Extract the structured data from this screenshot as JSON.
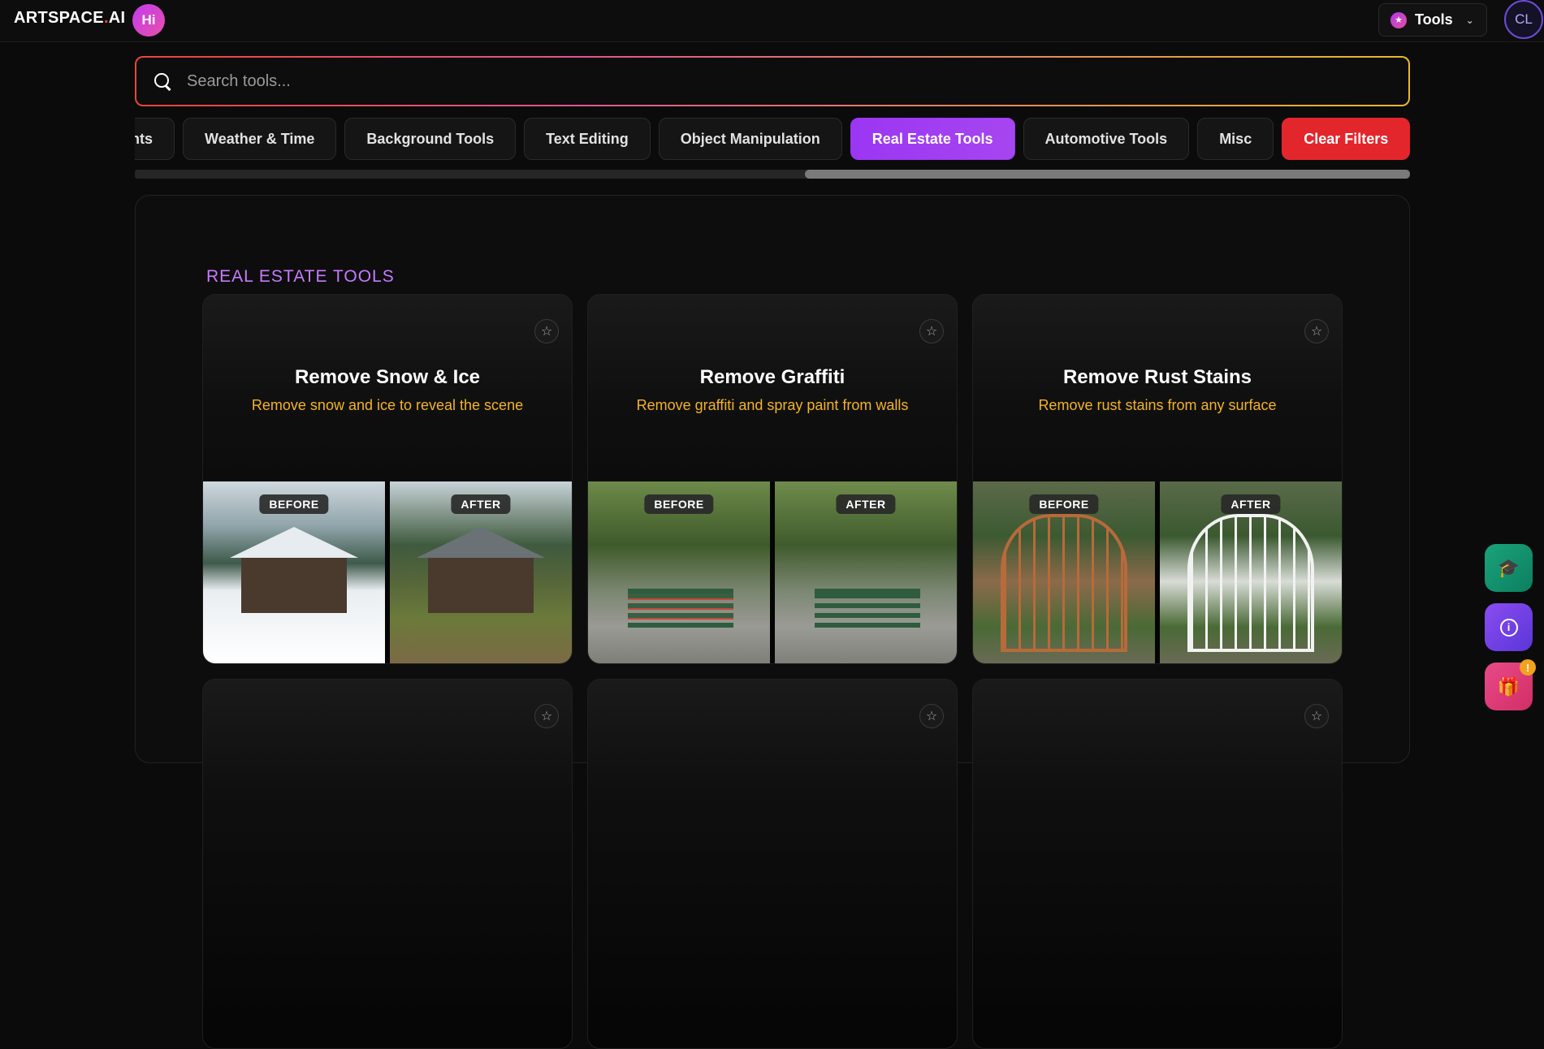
{
  "header": {
    "logo_main": "ARTSPACE",
    "logo_dot": ".",
    "logo_suffix": "AI",
    "hi_badge": "Hi",
    "tools_label": "Tools",
    "avatar_initials": "CL"
  },
  "search": {
    "placeholder": "Search tools..."
  },
  "filters": [
    {
      "label": "ements",
      "active": false
    },
    {
      "label": "Weather & Time",
      "active": false
    },
    {
      "label": "Background Tools",
      "active": false
    },
    {
      "label": "Text Editing",
      "active": false
    },
    {
      "label": "Object Manipulation",
      "active": false
    },
    {
      "label": "Real Estate Tools",
      "active": true
    },
    {
      "label": "Automotive Tools",
      "active": false
    },
    {
      "label": "Misc",
      "active": false
    }
  ],
  "clear_filters_label": "Clear Filters",
  "section": {
    "title": "REAL ESTATE TOOLS"
  },
  "cards": [
    {
      "title": "Remove Snow & Ice",
      "description": "Remove snow and ice to reveal the scene",
      "before_label": "BEFORE",
      "after_label": "AFTER"
    },
    {
      "title": "Remove Graffiti",
      "description": "Remove graffiti and spray paint from walls",
      "before_label": "BEFORE",
      "after_label": "AFTER"
    },
    {
      "title": "Remove Rust Stains",
      "description": "Remove rust stains from any surface",
      "before_label": "BEFORE",
      "after_label": "AFTER"
    }
  ],
  "fab": {
    "gift_badge": "!"
  },
  "colors": {
    "accent_purple": "#9b36f3",
    "clear_red": "#e3262c",
    "description_yellow": "#f3b324",
    "section_purple": "#c77bff"
  },
  "icons": [
    "search-icon",
    "star-icon",
    "chevron-down-icon",
    "graduation-cap-icon",
    "info-icon",
    "gift-icon"
  ]
}
